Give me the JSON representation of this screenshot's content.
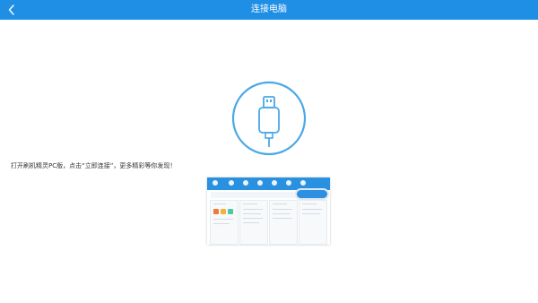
{
  "header": {
    "title": "连接电脑",
    "background_color": "#1f8fe6",
    "back_icon": "chevron-left-icon"
  },
  "main": {
    "usb_icon": "usb-plug-icon",
    "accent_color": "#4aa8e8",
    "instruction": "打开刷机精灵PC版，点击“立即连接”，更多精彩等你发现！",
    "preview_image": "pc-client-screenshot"
  }
}
